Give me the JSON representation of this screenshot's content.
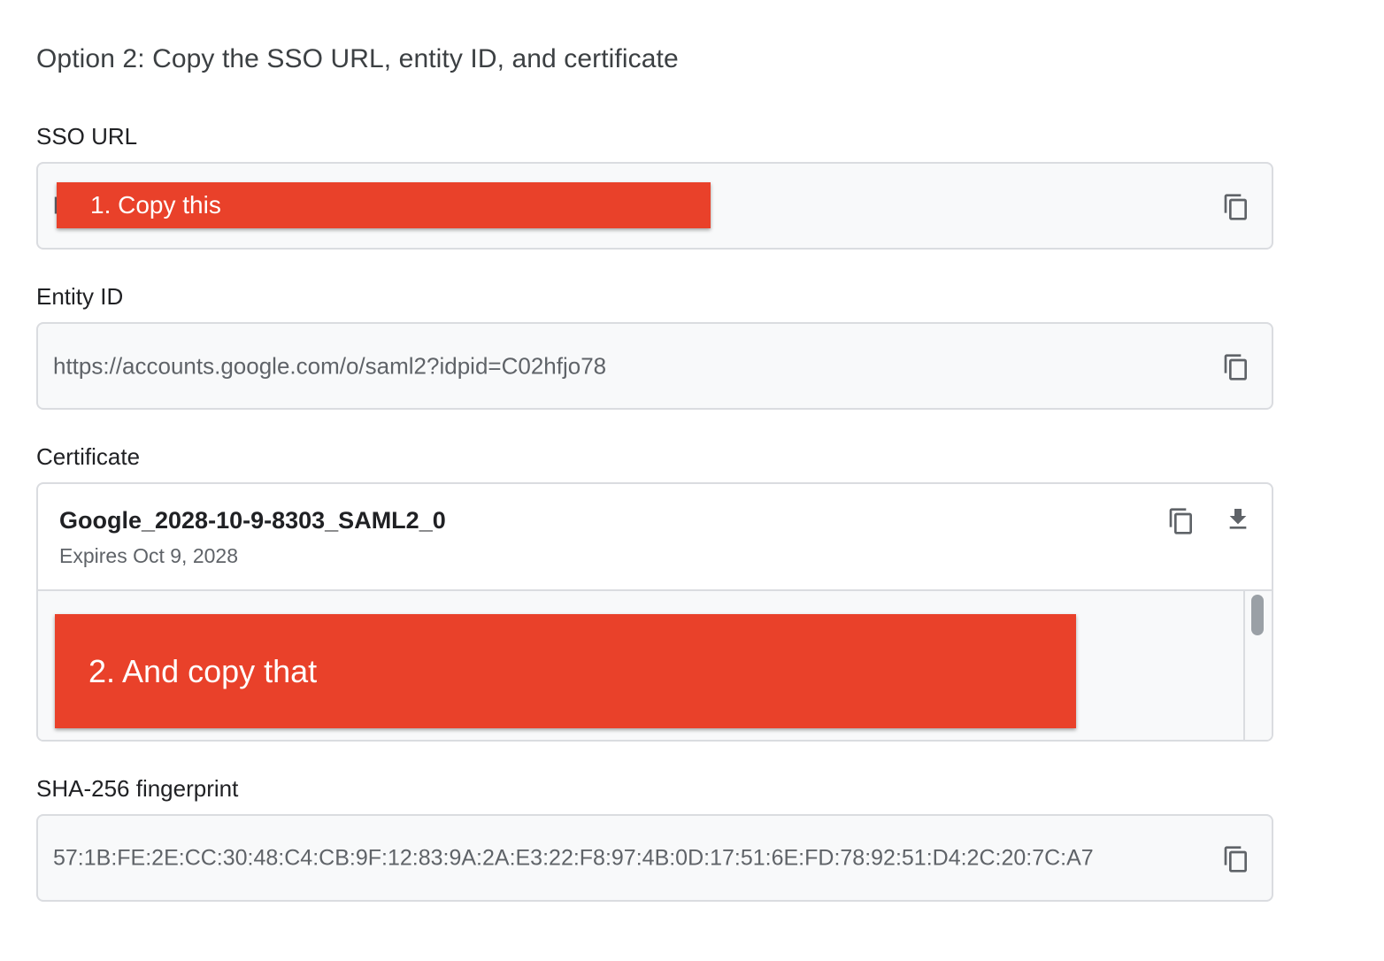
{
  "heading": "Option 2: Copy the SSO URL, entity ID, and certificate",
  "sso": {
    "label": "SSO URL",
    "value_visible": "h",
    "copy_icon": "copy-icon"
  },
  "entity": {
    "label": "Entity ID",
    "value": "https://accounts.google.com/o/saml2?idpid=C02hfjo78",
    "copy_icon": "copy-icon"
  },
  "certificate": {
    "label": "Certificate",
    "name": "Google_2028-10-9-8303_SAML2_0",
    "expires": "Expires Oct 9, 2028",
    "copy_icon": "copy-icon",
    "download_icon": "download-icon"
  },
  "fingerprint": {
    "label": "SHA-256 fingerprint",
    "value": "57:1B:FE:2E:CC:30:48:C4:CB:9F:12:83:9A:2A:E3:22:F8:97:4B:0D:17:51:6E:FD:78:92:51:D4:2C:20:7C:A7",
    "copy_icon": "copy-icon"
  },
  "annotations": {
    "first": "1. Copy this",
    "second": "2. And copy that",
    "color": "#e9412a"
  }
}
